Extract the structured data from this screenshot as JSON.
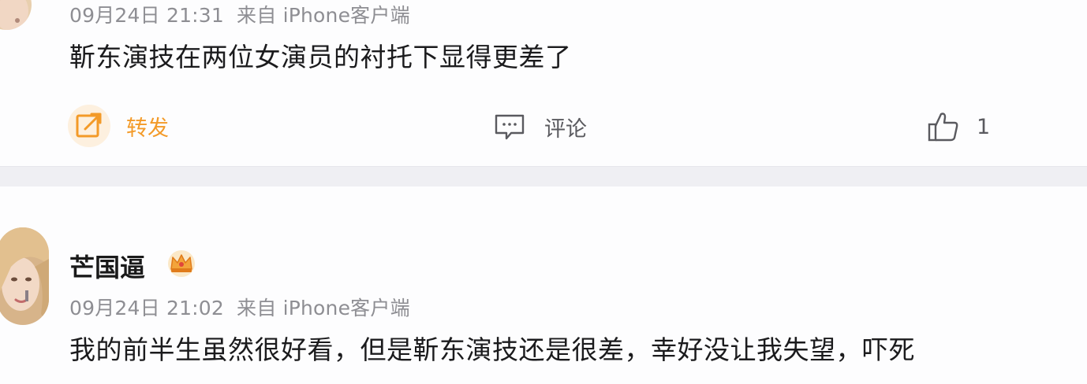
{
  "posts": [
    {
      "author": "",
      "date": "09月24日 21:31",
      "source": "来自 iPhone客户端",
      "text": "靳东演技在两位女演员的衬托下显得更差了",
      "actions": {
        "forward_label": "转发",
        "comment_label": "评论",
        "like_count": "1"
      }
    },
    {
      "author": "芒国逼",
      "date": "09月24日 21:02",
      "source": "来自 iPhone客户端",
      "text": "我的前半生虽然很好看，但是靳东演技还是很差，幸好没让我失望，吓死"
    }
  ],
  "icons": {
    "forward": "forward-icon",
    "comment": "comment-icon",
    "like": "thumbs-up-icon",
    "vip_badge": "crown-icon"
  },
  "colors": {
    "forward_accent": "#f39a28",
    "meta_gray": "#8e8e93",
    "text": "#1b1b1d"
  }
}
